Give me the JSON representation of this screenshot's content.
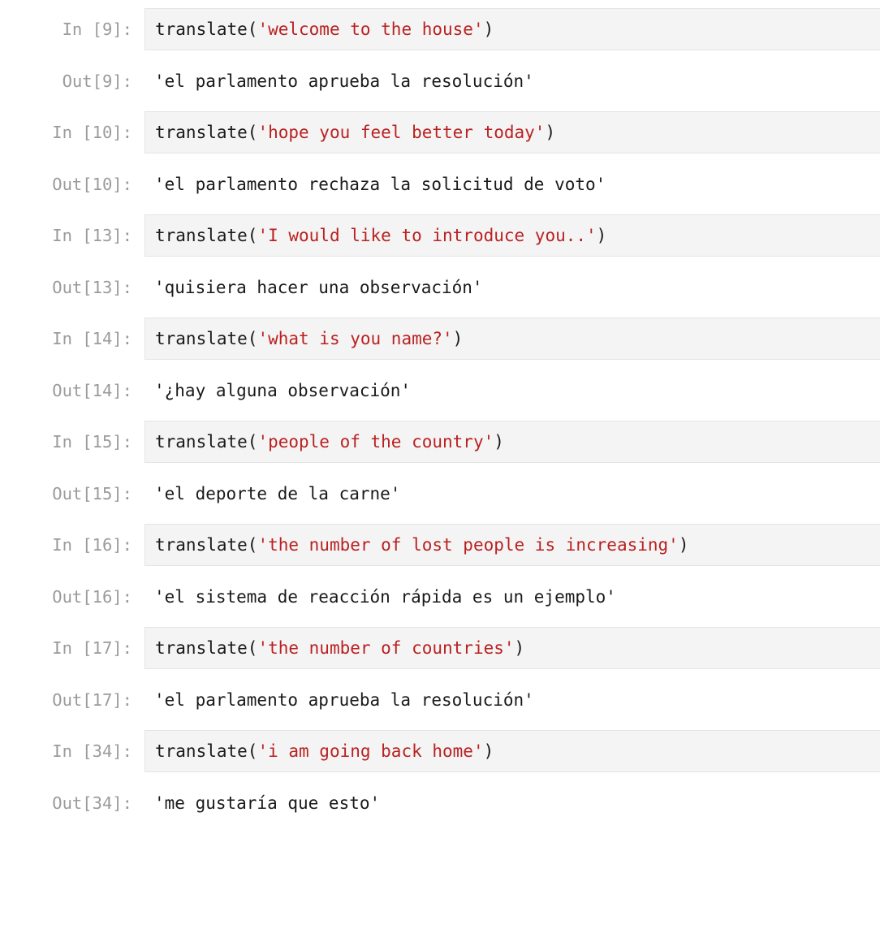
{
  "notebook": {
    "kind": "jupyter-notebook-cells",
    "language": "python",
    "function_name": "translate",
    "colors": {
      "string_literal": "#ba2121",
      "code_text": "#1a1a1a",
      "prompt_text": "#9b9b9b",
      "input_cell_background": "#f4f4f4",
      "input_cell_border": "#e4e4e4",
      "page_background": "#ffffff"
    },
    "cells": [
      {
        "in_prompt": "In [9]:",
        "out_prompt": "Out[9]:",
        "execution_count": 9,
        "code_prefix": "translate(",
        "code_string": "'welcome to the house'",
        "code_suffix": ")",
        "output": "'el parlamento aprueba la resolución'"
      },
      {
        "in_prompt": "In [10]:",
        "out_prompt": "Out[10]:",
        "execution_count": 10,
        "code_prefix": "translate(",
        "code_string": "'hope you feel better today'",
        "code_suffix": ")",
        "output": "'el parlamento rechaza la solicitud de voto'"
      },
      {
        "in_prompt": "In [13]:",
        "out_prompt": "Out[13]:",
        "execution_count": 13,
        "code_prefix": "translate(",
        "code_string": "'I would like to introduce you..'",
        "code_suffix": ")",
        "output": "'quisiera hacer una observación'"
      },
      {
        "in_prompt": "In [14]:",
        "out_prompt": "Out[14]:",
        "execution_count": 14,
        "code_prefix": "translate(",
        "code_string": "'what is you name?'",
        "code_suffix": ")",
        "output": "'¿hay alguna observación'"
      },
      {
        "in_prompt": "In [15]:",
        "out_prompt": "Out[15]:",
        "execution_count": 15,
        "code_prefix": "translate(",
        "code_string": "'people of the country'",
        "code_suffix": ")",
        "output": "'el deporte de la carne'"
      },
      {
        "in_prompt": "In [16]:",
        "out_prompt": "Out[16]:",
        "execution_count": 16,
        "code_prefix": "translate(",
        "code_string": "'the number of lost people is increasing'",
        "code_suffix": ")",
        "output": "'el sistema de reacción rápida es un ejemplo'"
      },
      {
        "in_prompt": "In [17]:",
        "out_prompt": "Out[17]:",
        "execution_count": 17,
        "code_prefix": "translate(",
        "code_string": "'the number of countries'",
        "code_suffix": ")",
        "output": "'el parlamento aprueba la resolución'"
      },
      {
        "in_prompt": "In [34]:",
        "out_prompt": "Out[34]:",
        "execution_count": 34,
        "code_prefix": "translate(",
        "code_string": "'i am going back home'",
        "code_suffix": ")",
        "output": "'me gustaría que esto'"
      }
    ]
  }
}
